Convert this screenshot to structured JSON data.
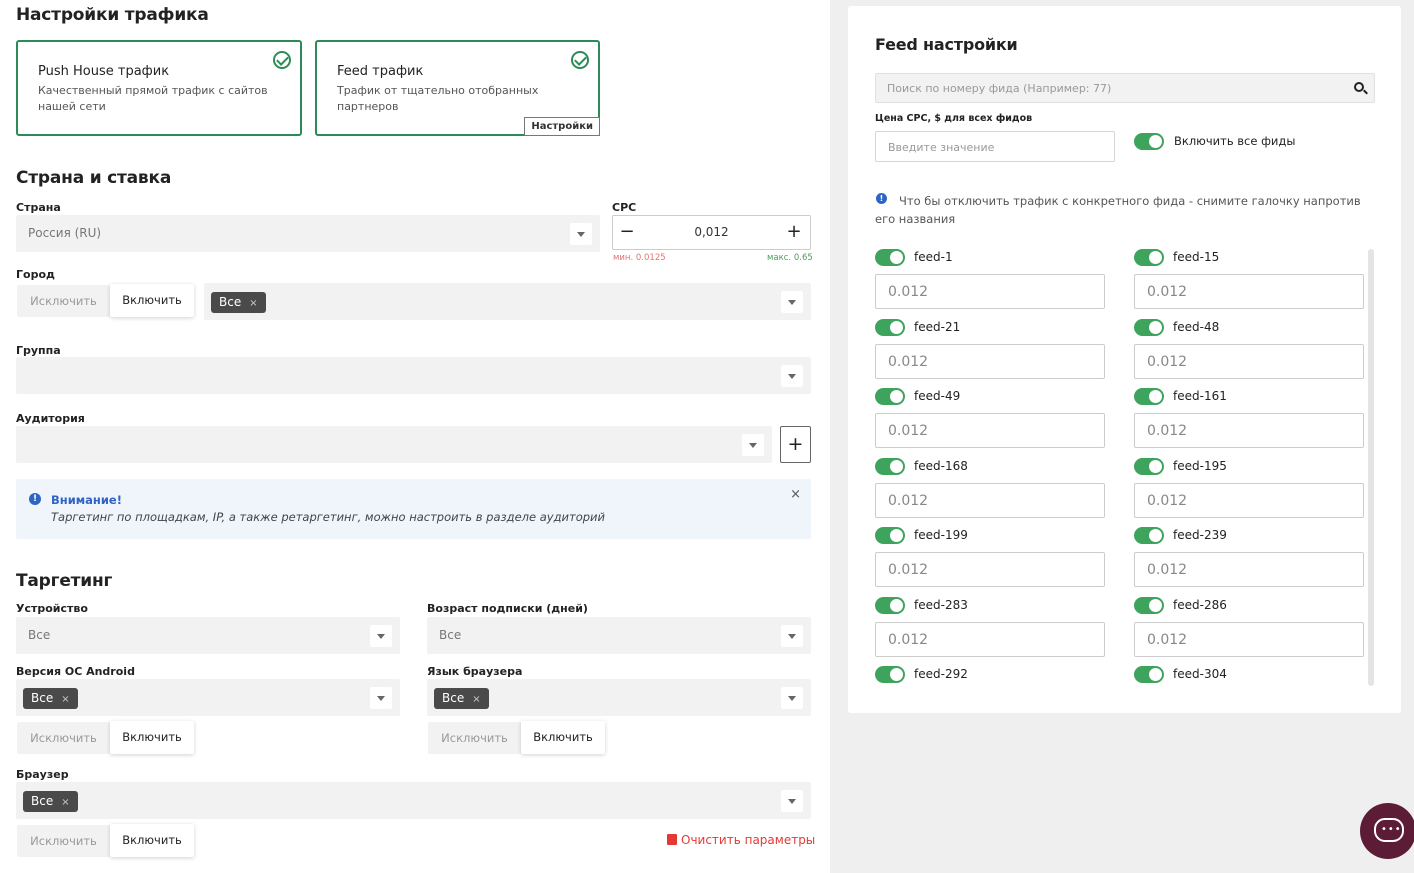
{
  "traffic": {
    "title": "Настройки трафика",
    "cards": [
      {
        "title": "Push House трафик",
        "desc": "Качественный прямой трафик с сайтов нашей сети"
      },
      {
        "title": "Feed трафик",
        "desc": "Трафик от тщательно отобранных партнеров",
        "button": "Настройки"
      }
    ]
  },
  "country_bid": {
    "title": "Страна и ставка",
    "country_label": "Страна",
    "country_value": "Россия (RU)",
    "cpc_label": "CPC",
    "cpc_value": "0,012",
    "cpc_minus": "−",
    "cpc_plus": "+",
    "cpc_min": "мин. 0.0125",
    "cpc_max": "макс. 0.65",
    "city_label": "Город",
    "city_exclude": "Исключить",
    "city_include": "Включить",
    "city_chip": "Все",
    "group_label": "Группа",
    "audience_label": "Аудитория",
    "audience_add": "+"
  },
  "alert": {
    "icon": "!",
    "title": "Внимание!",
    "text": "Таргетинг по площадкам, IP, а также ретаргетинг, можно настроить в разделе аудиторий",
    "close": "×"
  },
  "targeting": {
    "title": "Таргетинг",
    "device_label": "Устройство",
    "device_value": "Все",
    "sub_age_label": "Возраст подписки (дней)",
    "sub_age_value": "Все",
    "os_label": "Версия ОС Android",
    "os_chip": "Все",
    "lang_label": "Язык браузера",
    "lang_chip": "Все",
    "browser_label": "Браузер",
    "browser_chip": "Все",
    "exclude": "Исключить",
    "include": "Включить",
    "chip_x": "×",
    "clear": "Очистить параметры"
  },
  "feed": {
    "title": "Feed настройки",
    "search_placeholder": "Поиск по номеру фида (Например: 77)",
    "cpc_all_label": "Цена CPC, $ для всех фидов",
    "cpc_all_placeholder": "Введите значение",
    "enable_all": "Включить все фиды",
    "info_icon": "!",
    "info": "Что бы отключить трафик с конкретного фида - снимите галочку напротив его названия",
    "items": [
      {
        "name": "feed-1",
        "value": "0.012"
      },
      {
        "name": "feed-15",
        "value": "0.012"
      },
      {
        "name": "feed-21",
        "value": "0.012"
      },
      {
        "name": "feed-48",
        "value": "0.012"
      },
      {
        "name": "feed-49",
        "value": "0.012"
      },
      {
        "name": "feed-161",
        "value": "0.012"
      },
      {
        "name": "feed-168",
        "value": "0.012"
      },
      {
        "name": "feed-195",
        "value": "0.012"
      },
      {
        "name": "feed-199",
        "value": "0.012"
      },
      {
        "name": "feed-239",
        "value": "0.012"
      },
      {
        "name": "feed-283",
        "value": "0.012"
      },
      {
        "name": "feed-286",
        "value": "0.012"
      },
      {
        "name": "feed-292"
      },
      {
        "name": "feed-304"
      }
    ]
  },
  "colors": {
    "accent": "#3da35d",
    "card_border": "#2e8b57",
    "danger": "#e53935",
    "info": "#2f64c5",
    "chat": "#5c1c36"
  }
}
